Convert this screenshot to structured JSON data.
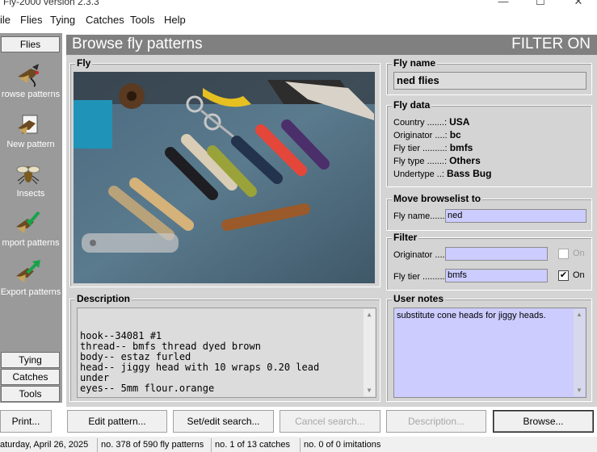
{
  "window": {
    "title": "Fly-2000  version 2.3.3",
    "min_glyph": "—",
    "max_glyph": "☐",
    "close_glyph": "✕"
  },
  "menu": [
    "ile",
    "Flies",
    "Tying",
    "Catches",
    "Tools",
    "Help"
  ],
  "sidebar": {
    "top_tab": "Flies",
    "items": [
      {
        "label": "rowse patterns",
        "icon": "fly-icon"
      },
      {
        "label": "New pattern",
        "icon": "new-pattern-icon"
      },
      {
        "label": "Insects",
        "icon": "insect-icon"
      },
      {
        "label": "mport patterns",
        "icon": "import-fly-icon"
      },
      {
        "label": "Export patterns",
        "icon": "export-fly-icon"
      }
    ],
    "bottom_tabs": [
      "Tying",
      "Catches",
      "Tools"
    ]
  },
  "header": {
    "title": "Browse fly patterns",
    "filter_state": "FILTER ON"
  },
  "fly_group": {
    "legend": "Fly"
  },
  "description": {
    "legend": "Description",
    "text": "hook--34081 #1\nthread-- bmfs thread dyed brown\nbody-- estaz furled\nhead-- jiggy head with 10 wraps 0.20 lead\nunder\neyes-- 5mm flour.orange"
  },
  "fly_name": {
    "legend": "Fly name",
    "value": "ned flies"
  },
  "fly_data": {
    "legend": "Fly data",
    "rows": [
      {
        "label": "Country .......:",
        "value": "USA"
      },
      {
        "label": "Originator ....:",
        "value": "bc"
      },
      {
        "label": "Fly tier .........:",
        "value": "bmfs"
      },
      {
        "label": "Fly type .......:",
        "value": "Others"
      },
      {
        "label": "Undertype ..:",
        "value": "Bass Bug"
      }
    ]
  },
  "move_browselist": {
    "legend": "Move browselist to",
    "label": "Fly name......:",
    "value": "ned"
  },
  "filter": {
    "legend": "Filter",
    "originator_label": "Originator ....:",
    "originator_value": "",
    "originator_toggle": "On",
    "flytier_label": "Fly tier ..........:",
    "flytier_value": "bmfs",
    "flytier_toggle": "On",
    "check_mark": "✔"
  },
  "user_notes": {
    "legend": "User notes",
    "text": "substitute cone heads for jiggy heads."
  },
  "buttons": {
    "print": "Print...",
    "edit_pattern": "Edit pattern...",
    "set_edit_search": "Set/edit search...",
    "cancel_search": "Cancel search...",
    "description": "Description...",
    "browse": "Browse..."
  },
  "status": {
    "date": "aturday, April 26, 2025",
    "patterns": "no. 378 of 590 fly patterns",
    "catches": "no. 1 of 13 catches",
    "imitations": "no. 0 of 0 imitations"
  },
  "colors": {
    "header_bg": "#808080",
    "panel_bg": "#d4d4d4",
    "input_bg": "#ccccff",
    "sidebar_bg": "#9a9a9a"
  }
}
